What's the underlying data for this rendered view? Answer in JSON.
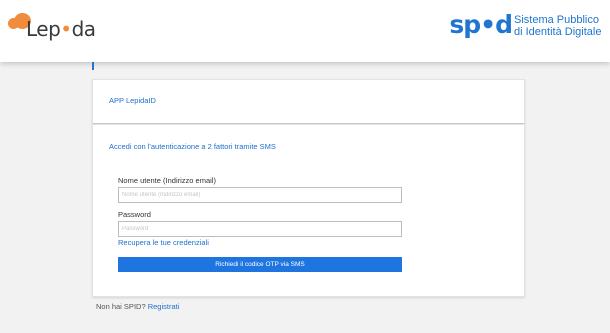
{
  "header": {
    "brand": "Lepida",
    "spid": {
      "word": "spid",
      "line1": "Sistema Pubblico",
      "line2": "di Identità Digitale"
    }
  },
  "app_panel": {
    "app_link": "APP LepidaID"
  },
  "login_panel": {
    "twofa_link": "Accedi con l'autenticazione a 2 fattori tramite SMS",
    "username_label": "Nome utente (Indirizzo email)",
    "username_placeholder": "Nome utente (Indirizzo email)",
    "username_value": "",
    "password_label": "Password",
    "password_placeholder": "Password",
    "password_value": "",
    "recover_link": "Recupera le tue credenziali",
    "otp_button": "Richiedi il codice OTP via SMS"
  },
  "footer": {
    "question": "Non hai SPID?",
    "register_link": "Registrati"
  },
  "colors": {
    "accent": "#1f75cf",
    "brand_orange": "#f08c3c",
    "button": "#1f75e0"
  }
}
